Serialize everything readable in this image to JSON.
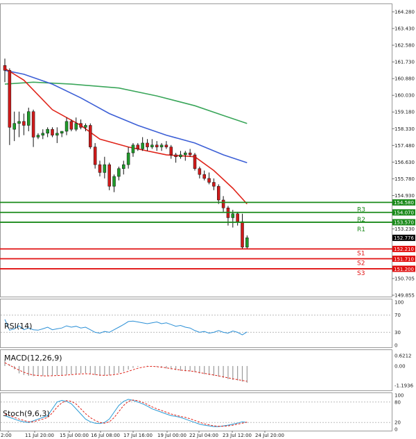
{
  "chart_data": {
    "type": "candlestick",
    "main": {
      "ylim": [
        149.855,
        164.28
      ],
      "yticks": [
        "164.280",
        "163.430",
        "162.580",
        "161.730",
        "160.880",
        "160.030",
        "159.180",
        "158.330",
        "157.480",
        "156.630",
        "155.780",
        "154.930",
        "153.230",
        "150.705",
        "149.855"
      ],
      "current_price": "152.776",
      "xticks": [
        "2:00",
        "11 Jul 20:00",
        "15 Jul 00:00",
        "16 Jul 08:00",
        "17 Jul 16:00",
        "19 Jul 00:00",
        "22 Jul 04:00",
        "23 Jul 12:00",
        "24 Jul 20:00"
      ],
      "candles": [
        [
          161.55,
          161.9,
          160.7,
          161.3
        ],
        [
          161.3,
          161.4,
          157.5,
          158.4
        ],
        [
          158.3,
          159.2,
          157.7,
          158.6
        ],
        [
          158.6,
          159.2,
          157.9,
          158.7
        ],
        [
          158.7,
          159.1,
          158.0,
          158.5
        ],
        [
          158.5,
          159.4,
          158.2,
          159.2
        ],
        [
          159.2,
          159.3,
          157.4,
          157.9
        ],
        [
          157.9,
          158.1,
          157.8,
          158.0
        ],
        [
          158.0,
          158.3,
          157.8,
          158.1
        ],
        [
          158.1,
          158.4,
          157.9,
          158.3
        ],
        [
          158.3,
          158.4,
          157.9,
          158.0
        ],
        [
          158.0,
          158.4,
          157.6,
          158.1
        ],
        [
          158.1,
          158.2,
          157.9,
          158.2
        ],
        [
          158.2,
          158.9,
          158.0,
          158.7
        ],
        [
          158.7,
          158.8,
          158.2,
          158.3
        ],
        [
          158.3,
          158.9,
          158.2,
          158.6
        ],
        [
          158.6,
          158.8,
          158.3,
          158.4
        ],
        [
          158.4,
          158.6,
          158.2,
          158.5
        ],
        [
          158.5,
          158.6,
          157.3,
          157.4
        ],
        [
          157.4,
          157.6,
          156.3,
          156.5
        ],
        [
          156.5,
          156.7,
          155.9,
          156.1
        ],
        [
          156.1,
          156.9,
          155.8,
          156.5
        ],
        [
          156.5,
          156.6,
          155.2,
          155.4
        ],
        [
          155.4,
          156.0,
          155.1,
          155.9
        ],
        [
          155.9,
          156.4,
          155.7,
          156.3
        ],
        [
          156.3,
          156.7,
          156.0,
          156.5
        ],
        [
          156.5,
          157.4,
          156.3,
          157.1
        ],
        [
          157.1,
          157.6,
          156.9,
          157.5
        ],
        [
          157.5,
          157.6,
          157.2,
          157.3
        ],
        [
          157.3,
          157.9,
          157.2,
          157.6
        ],
        [
          157.6,
          157.8,
          157.2,
          157.4
        ],
        [
          157.4,
          157.8,
          157.3,
          157.5
        ],
        [
          157.5,
          157.7,
          157.2,
          157.4
        ],
        [
          157.4,
          157.6,
          157.2,
          157.5
        ],
        [
          157.5,
          157.7,
          157.3,
          157.4
        ],
        [
          157.4,
          157.5,
          156.8,
          157.0
        ],
        [
          157.0,
          157.1,
          156.6,
          156.9
        ],
        [
          156.9,
          157.2,
          156.8,
          157.0
        ],
        [
          157.0,
          157.2,
          156.7,
          157.1
        ],
        [
          157.1,
          157.3,
          156.9,
          157.0
        ],
        [
          157.0,
          157.1,
          156.2,
          156.3
        ],
        [
          156.3,
          156.4,
          155.8,
          156.0
        ],
        [
          156.0,
          156.2,
          155.7,
          155.8
        ],
        [
          155.8,
          156.1,
          155.5,
          155.6
        ],
        [
          155.6,
          155.8,
          155.2,
          155.4
        ],
        [
          155.4,
          155.5,
          154.5,
          154.7
        ],
        [
          154.7,
          154.9,
          154.1,
          154.3
        ],
        [
          154.3,
          154.4,
          153.4,
          153.8
        ],
        [
          153.8,
          154.2,
          153.3,
          154.0
        ],
        [
          154.0,
          154.1,
          153.4,
          153.6
        ],
        [
          153.6,
          154.0,
          152.2,
          152.3
        ],
        [
          152.3,
          152.9,
          152.2,
          152.78
        ]
      ],
      "ma_fast": [
        [
          0,
          161.4
        ],
        [
          4,
          160.8
        ],
        [
          10,
          159.3
        ],
        [
          16,
          158.5
        ],
        [
          20,
          157.8
        ],
        [
          26,
          157.4
        ],
        [
          34,
          157.0
        ],
        [
          40,
          156.9
        ],
        [
          44,
          156.2
        ],
        [
          48,
          155.3
        ],
        [
          51,
          154.5
        ]
      ],
      "ma_mid": [
        [
          0,
          161.3
        ],
        [
          4,
          161.1
        ],
        [
          10,
          160.6
        ],
        [
          16,
          159.9
        ],
        [
          22,
          159.1
        ],
        [
          28,
          158.5
        ],
        [
          34,
          158.0
        ],
        [
          40,
          157.6
        ],
        [
          46,
          157.0
        ],
        [
          51,
          156.6
        ]
      ],
      "ma_slow": [
        [
          0,
          160.6
        ],
        [
          6,
          160.7
        ],
        [
          14,
          160.6
        ],
        [
          24,
          160.4
        ],
        [
          32,
          160.0
        ],
        [
          40,
          159.5
        ],
        [
          46,
          159.0
        ],
        [
          51,
          158.6
        ]
      ]
    },
    "levels": [
      {
        "name": "R3",
        "value": 154.58,
        "label": "154.580",
        "color": "#1a8a1a"
      },
      {
        "name": "R2",
        "value": 154.07,
        "label": "154.070",
        "color": "#1a8a1a"
      },
      {
        "name": "R1",
        "value": 153.57,
        "label": "153.570",
        "color": "#1a8a1a"
      },
      {
        "name": "S1",
        "value": 152.21,
        "label": "152.210",
        "color": "#e01010"
      },
      {
        "name": "S2",
        "value": 151.71,
        "label": "151.710",
        "color": "#e01010"
      },
      {
        "name": "S3",
        "value": 151.2,
        "label": "151.200",
        "color": "#e01010"
      }
    ],
    "rsi": {
      "label": "RSI(14)",
      "ylim": [
        0,
        100
      ],
      "yticks": [
        "100",
        "70",
        "30",
        "0"
      ],
      "values": [
        60,
        35,
        38,
        45,
        36,
        40,
        36,
        35,
        38,
        42,
        36,
        38,
        40,
        45,
        42,
        44,
        40,
        42,
        36,
        30,
        28,
        32,
        30,
        36,
        42,
        48,
        55,
        56,
        54,
        52,
        50,
        52,
        54,
        50,
        52,
        48,
        44,
        46,
        42,
        40,
        34,
        30,
        32,
        28,
        30,
        34,
        30,
        28,
        33,
        30,
        24,
        31
      ]
    },
    "macd": {
      "label": "MACD(12,26,9)",
      "yticks": [
        "0.6212",
        "0.00",
        "-1.1936"
      ],
      "ylim": [
        -1.4,
        0.8
      ],
      "histogram": [
        0.4,
        0.1,
        -0.2,
        -0.45,
        -0.55,
        -0.6,
        -0.62,
        -0.6,
        -0.6,
        -0.58,
        -0.57,
        -0.56,
        -0.55,
        -0.53,
        -0.5,
        -0.48,
        -0.45,
        -0.43,
        -0.46,
        -0.55,
        -0.6,
        -0.58,
        -0.55,
        -0.5,
        -0.42,
        -0.33,
        -0.22,
        -0.12,
        -0.05,
        0.0,
        0.02,
        0.0,
        -0.05,
        -0.1,
        -0.15,
        -0.2,
        -0.25,
        -0.3,
        -0.32,
        -0.33,
        -0.38,
        -0.45,
        -0.5,
        -0.55,
        -0.6,
        -0.65,
        -0.72,
        -0.8,
        -0.85,
        -0.88,
        -0.95,
        -1.02
      ],
      "signal": [
        0.2,
        0.05,
        -0.1,
        -0.25,
        -0.38,
        -0.48,
        -0.55,
        -0.58,
        -0.6,
        -0.6,
        -0.59,
        -0.58,
        -0.57,
        -0.55,
        -0.53,
        -0.5,
        -0.48,
        -0.47,
        -0.48,
        -0.52,
        -0.56,
        -0.57,
        -0.56,
        -0.53,
        -0.48,
        -0.41,
        -0.32,
        -0.23,
        -0.14,
        -0.07,
        -0.03,
        -0.02,
        -0.04,
        -0.07,
        -0.11,
        -0.16,
        -0.2,
        -0.25,
        -0.28,
        -0.3,
        -0.34,
        -0.4,
        -0.45,
        -0.5,
        -0.55,
        -0.6,
        -0.66,
        -0.72,
        -0.78,
        -0.83,
        -0.88,
        -0.93
      ]
    },
    "stoch": {
      "label": "Stoch(9,6,3)",
      "ylim": [
        0,
        100
      ],
      "yticks": [
        "100",
        "80",
        "20",
        "0"
      ],
      "main": [
        40,
        35,
        30,
        25,
        22,
        20,
        25,
        30,
        35,
        40,
        60,
        80,
        85,
        82,
        75,
        60,
        45,
        30,
        22,
        18,
        17,
        20,
        30,
        50,
        70,
        82,
        88,
        85,
        80,
        75,
        68,
        60,
        55,
        50,
        45,
        40,
        38,
        35,
        30,
        25,
        20,
        15,
        12,
        10,
        8,
        8,
        10,
        12,
        15,
        18,
        22,
        20
      ],
      "signal": [
        45,
        40,
        35,
        30,
        26,
        22,
        22,
        26,
        30,
        35,
        48,
        65,
        78,
        84,
        82,
        74,
        60,
        46,
        34,
        26,
        20,
        18,
        22,
        34,
        52,
        70,
        82,
        86,
        84,
        79,
        73,
        66,
        60,
        55,
        50,
        45,
        41,
        38,
        35,
        31,
        26,
        21,
        16,
        13,
        10,
        9,
        9,
        10,
        12,
        15,
        18,
        21
      ]
    }
  }
}
